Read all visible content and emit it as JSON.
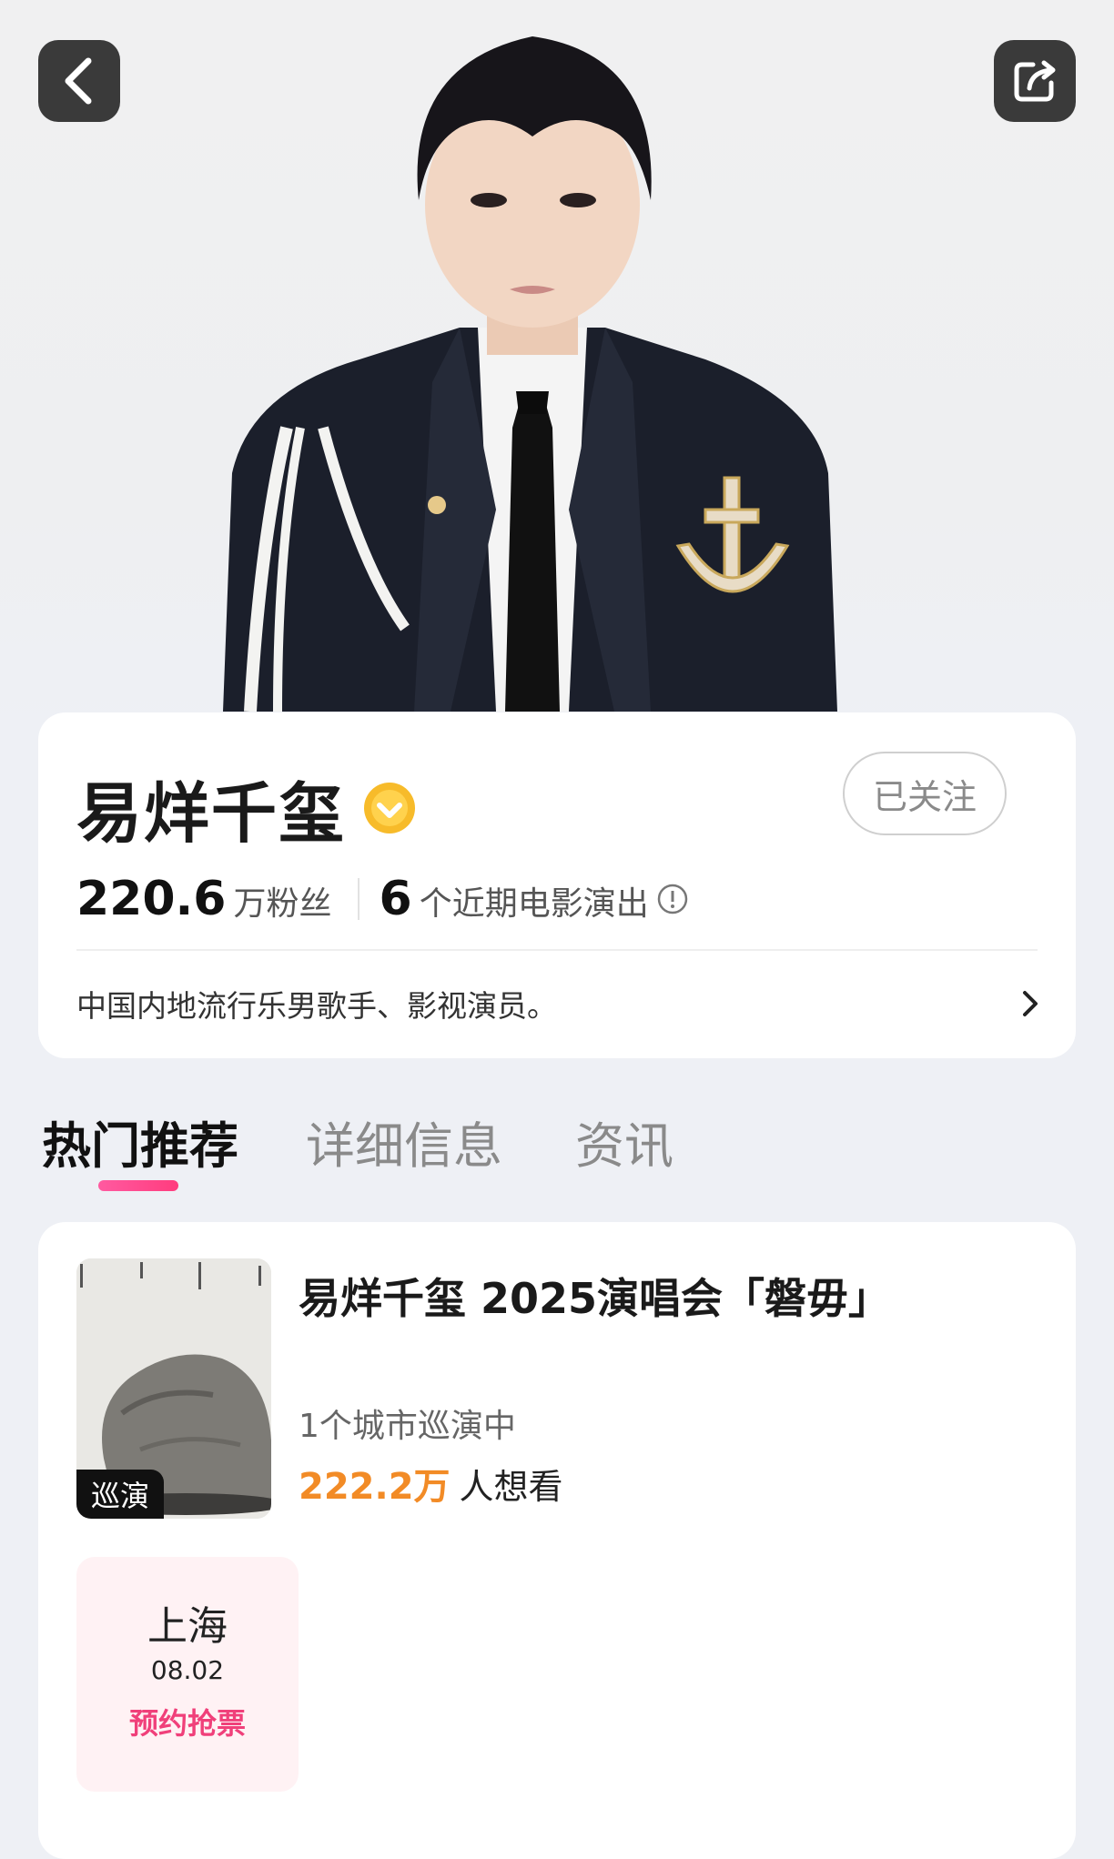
{
  "header": {
    "back_icon": "chevron-left-icon",
    "share_icon": "share-icon"
  },
  "profile": {
    "name": "易烊千玺",
    "verified_icon": "verified-badge-icon",
    "follow_label": "已关注",
    "fans_count": "220.6",
    "fans_unit": "万粉丝",
    "shows_count": "6",
    "shows_unit": "个近期电影演出",
    "info_icon": "info-icon",
    "bio": "中国内地流行乐男歌手、影视演员。",
    "bio_chevron": "chevron-right-icon"
  },
  "tabs": [
    {
      "label": "热门推荐",
      "active": true
    },
    {
      "label": "详细信息",
      "active": false
    },
    {
      "label": "资讯",
      "active": false
    }
  ],
  "event": {
    "title": "易烊千玺 2025演唱会「磐毋」",
    "poster_badge": "巡演",
    "cities_text": "1个城市巡演中",
    "want_count": "222.2万",
    "want_text": "人想看",
    "shows": [
      {
        "city": "上海",
        "date": "08.02",
        "cta": "预约抢票"
      }
    ]
  },
  "colors": {
    "accent_pink": "#ff3c7e",
    "want_orange": "#f28b26",
    "verified_gold": "#f7bb2a"
  }
}
